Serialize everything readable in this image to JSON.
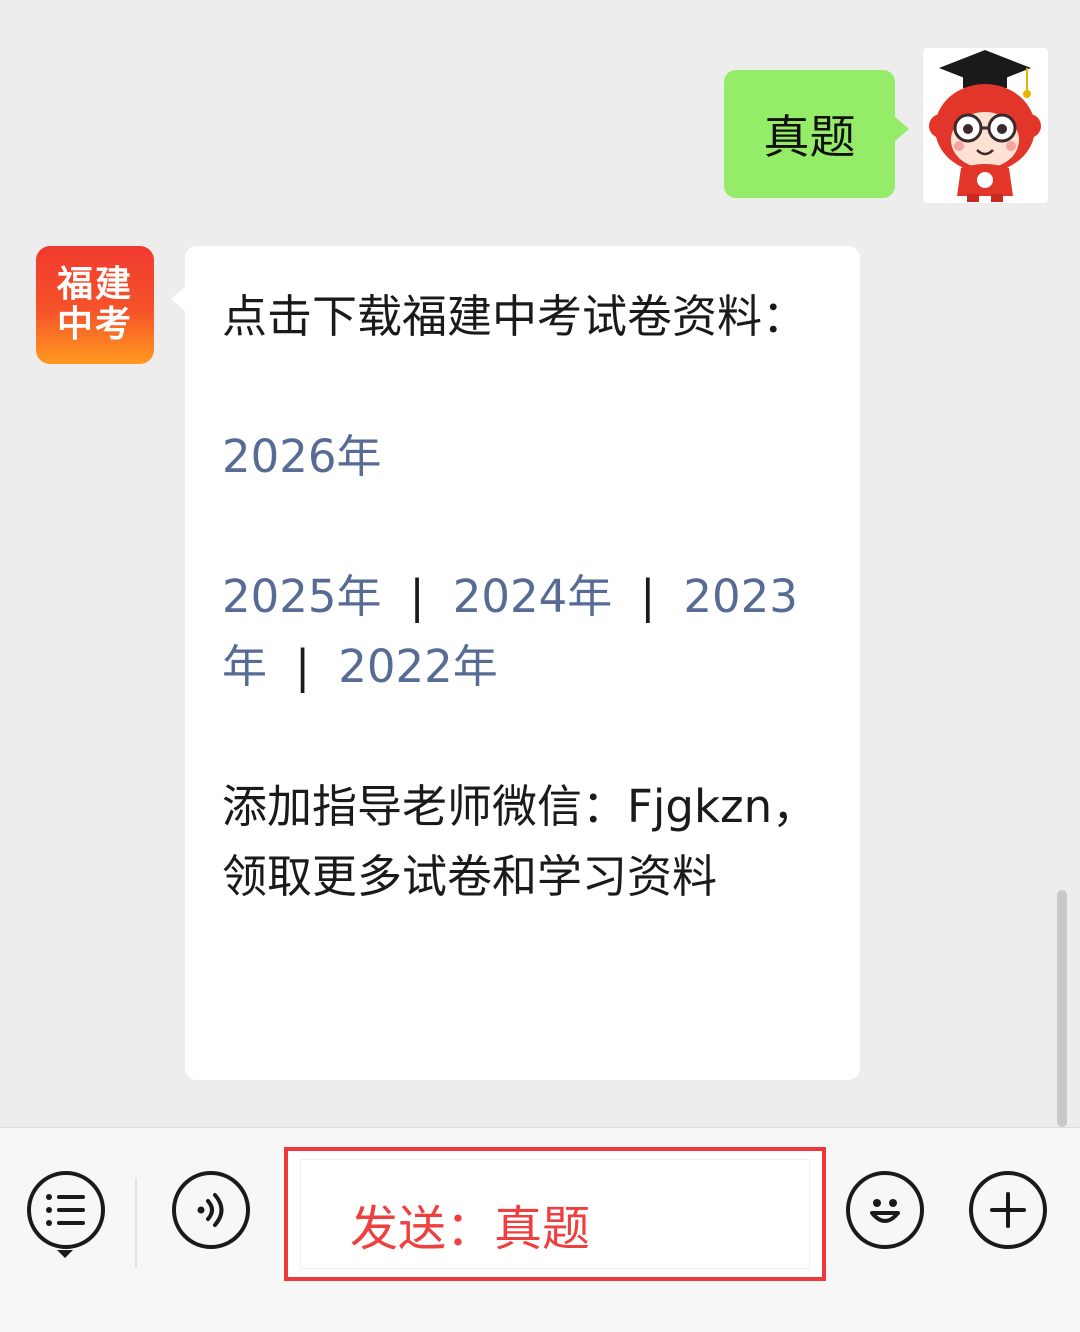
{
  "outgoing": {
    "text": "真题"
  },
  "incoming": {
    "account_logo": {
      "line1": "福建",
      "line2": "中考"
    },
    "intro": "点击下载福建中考试卷资料：",
    "year_2026": "2026年",
    "years": [
      "2025年",
      "2024年",
      "2023年",
      "2022年"
    ],
    "separator": "|",
    "footer": "添加指导老师微信：Fjgkzn，领取更多试卷和学习资料"
  },
  "input_bar": {
    "input_value": "发送：真题",
    "menu_icon": "list-menu-icon",
    "voice_icon": "voice-icon",
    "emoji_icon": "emoji-icon",
    "plus_icon": "plus-icon"
  },
  "colors": {
    "chat_background": "#ededed",
    "outgoing_bubble": "#95ec69",
    "link": "#576b95",
    "highlight_border": "#f0373c",
    "input_text": "#ef3f3f"
  }
}
